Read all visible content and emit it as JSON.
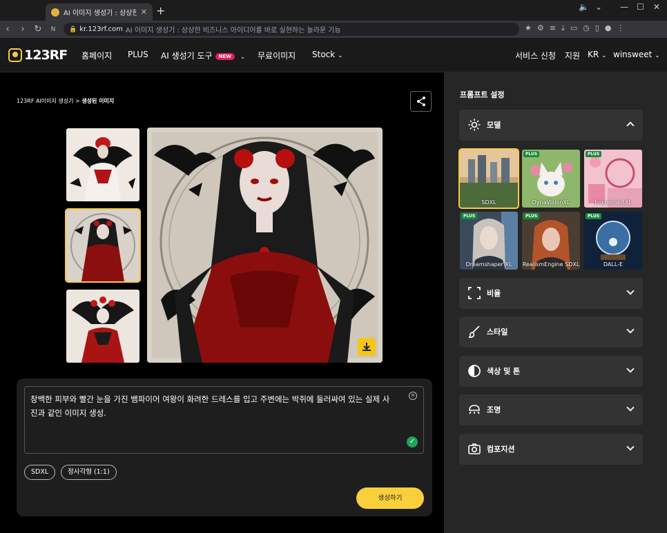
{
  "browser": {
    "tab_title": "AI 이미지 생성기 : 상상한 비",
    "tab_close": "✕",
    "new_tab": "+",
    "url_host": "kr.123rf.com",
    "url_rest": "AI 이미지 생성기 : 상상한 비즈니스 아이디어를 바로 실현하는 놀라운 기능"
  },
  "nav": {
    "logo": "123RF",
    "items": [
      "홈페이지",
      "PLUS",
      "AI 생성기 도구",
      "무료이미지",
      "Stock"
    ],
    "new_badge": "NEW",
    "right": [
      "서비스 신청",
      "지원",
      "KR",
      "winsweet"
    ]
  },
  "breadcrumb": {
    "root": "123RF AI이미지 생성기 >",
    "current": "생성된 이미지"
  },
  "prompt": {
    "text": "창백한 피부와 빨간 눈을 가진 뱀파이어 여왕이 화려한 드레스를 입고 주변에는 박쥐에 둘러싸여 있는 실제 사진과 같인 이미지 생성.",
    "chips": [
      "SDXL",
      "정사각형 (1:1)"
    ],
    "generate_label": "생성하기"
  },
  "panel": {
    "title": "프롬프트 설정",
    "sections": [
      {
        "label": "모델",
        "icon": "gear-icon",
        "expanded": true
      },
      {
        "label": "비율",
        "icon": "aspect-ratio-icon",
        "expanded": false
      },
      {
        "label": "스타일",
        "icon": "brush-icon",
        "expanded": false
      },
      {
        "label": "색상 및 톤",
        "icon": "contrast-icon",
        "expanded": false
      },
      {
        "label": "조명",
        "icon": "lamp-icon",
        "expanded": false
      },
      {
        "label": "컴포지션",
        "icon": "camera-icon",
        "expanded": false
      }
    ],
    "models": [
      {
        "name": "SDXL",
        "plus": false,
        "selected": true
      },
      {
        "name": "DynaVisionXL",
        "plus": true,
        "selected": false
      },
      {
        "name": "JuggernautXL",
        "plus": true,
        "selected": false
      },
      {
        "name": "Dreamshaper XL",
        "plus": true,
        "selected": false
      },
      {
        "name": "RealismEngine SDXL",
        "plus": true,
        "selected": false
      },
      {
        "name": "DALL-E",
        "plus": true,
        "selected": false
      }
    ],
    "plus_badge": "PLUS"
  },
  "colors": {
    "accent_yellow": "#f9cf3c",
    "new_badge": "#e01e5a",
    "plus_badge": "#1a8a3a",
    "check_green": "#22a559"
  }
}
